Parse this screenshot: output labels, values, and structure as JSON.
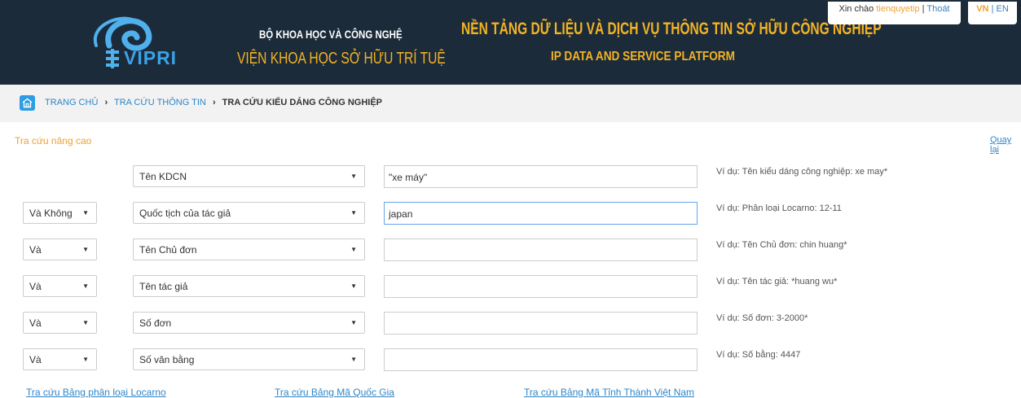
{
  "header": {
    "logo_text": "VIPRI",
    "org_line1": "BỘ KHOA HỌC VÀ CÔNG NGHỆ",
    "org_line2": "VIỆN KHOA HỌC SỞ HỮU TRÍ TUỆ",
    "platform_vn": "NỀN TẢNG DỮ LIỆU VÀ DỊCH VỤ THÔNG TIN SỞ HỮU CÔNG NGHIỆP",
    "platform_en": "IP DATA AND SERVICE PLATFORM",
    "greeting": "Xin chào",
    "username": "tienquyetip",
    "separator": "|",
    "logout": "Thoát",
    "lang_vn": "VN",
    "lang_sep": "|",
    "lang_en": "EN"
  },
  "breadcrumb": {
    "items": [
      "TRANG CHỦ",
      "TRA CỨU THÔNG TIN",
      "TRA CỨU KIỂU DÁNG CÔNG NGHIỆP"
    ],
    "separator": "›"
  },
  "search": {
    "title": "Tra cứu nâng cao",
    "back": "Quay lại",
    "rows": [
      {
        "operator": "",
        "field": "Tên KDCN",
        "value": "\"xe máy\"",
        "hint": "Ví dụ: Tên kiểu dáng công nghiệp: xe may*"
      },
      {
        "operator": "Và Không",
        "field": "Quốc tịch của tác giả",
        "value": "japan",
        "hint": "Ví dụ: Phân loại Locarno: 12-11"
      },
      {
        "operator": "Và",
        "field": "Tên Chủ đơn",
        "value": "",
        "hint": "Ví dụ: Tên Chủ đơn: chin huang*"
      },
      {
        "operator": "Và",
        "field": "Tên tác giả",
        "value": "",
        "hint": "Ví dụ: Tên tác giả: *huang wu*"
      },
      {
        "operator": "Và",
        "field": "Số đơn",
        "value": "",
        "hint": "Ví dụ: Số đơn: 3-2000*"
      },
      {
        "operator": "Và",
        "field": "Số văn bằng",
        "value": "",
        "hint": "Ví dụ: Số bằng: 4447"
      }
    ]
  },
  "links": {
    "locarno": "Tra cứu Bảng phân loại Locarno",
    "country": "Tra cứu Bảng Mã Quốc Gia",
    "province": "Tra cứu Bảng Mã Tỉnh Thành Việt Nam"
  },
  "colors": {
    "header_bg": "#1b2b3a",
    "accent_yellow": "#f3b323",
    "link_blue": "#2e86c9",
    "orange": "#f0a030"
  },
  "icons": {
    "home": "home-icon",
    "dropdown": "caret-down-icon",
    "logo": "vipri-logo"
  }
}
